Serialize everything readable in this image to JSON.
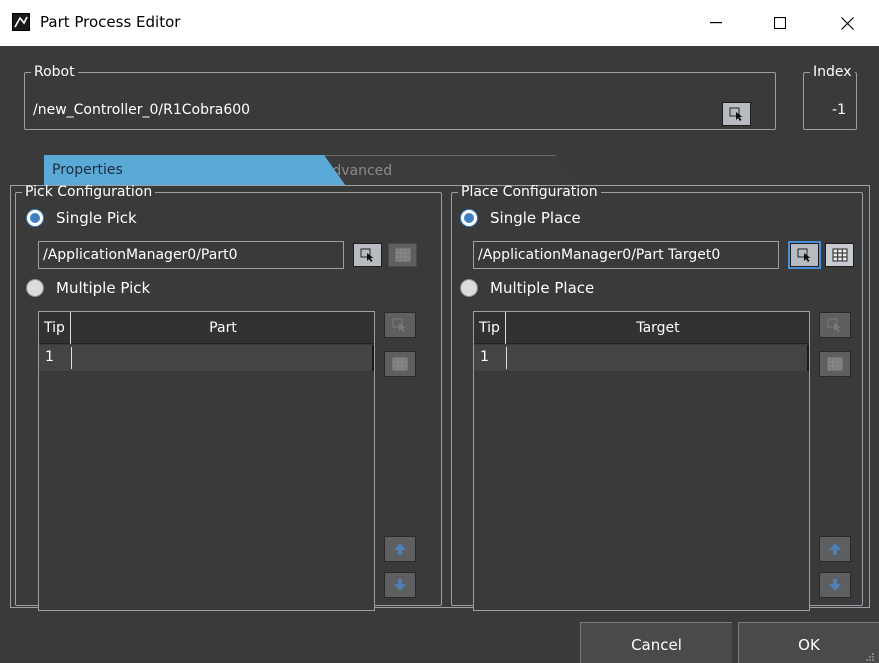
{
  "window": {
    "title": "Part Process Editor"
  },
  "robot": {
    "label": "Robot",
    "path": "/new_Controller_0/R1Cobra600"
  },
  "index": {
    "label": "Index",
    "value": "-1"
  },
  "tabs": [
    {
      "label": "Properties",
      "active": true
    },
    {
      "label": "Advanced",
      "active": false
    }
  ],
  "pick": {
    "legend": "Pick Configuration",
    "single_label": "Single Pick",
    "multiple_label": "Multiple Pick",
    "path": "/ApplicationManager0/Part0",
    "columns": [
      "Tip",
      "Part"
    ],
    "rows": [
      {
        "tip": "1",
        "value": ""
      }
    ]
  },
  "place": {
    "legend": "Place Configuration",
    "single_label": "Single Place",
    "multiple_label": "Multiple Place",
    "path": "/ApplicationManager0/Part Target0",
    "columns": [
      "Tip",
      "Target"
    ],
    "rows": [
      {
        "tip": "1",
        "value": ""
      }
    ]
  },
  "buttons": {
    "cancel": "Cancel",
    "ok": "OK"
  },
  "colors": {
    "accent": "#5aa9d6",
    "radio": "#3d7fc2",
    "background": "#3a3a3a"
  }
}
